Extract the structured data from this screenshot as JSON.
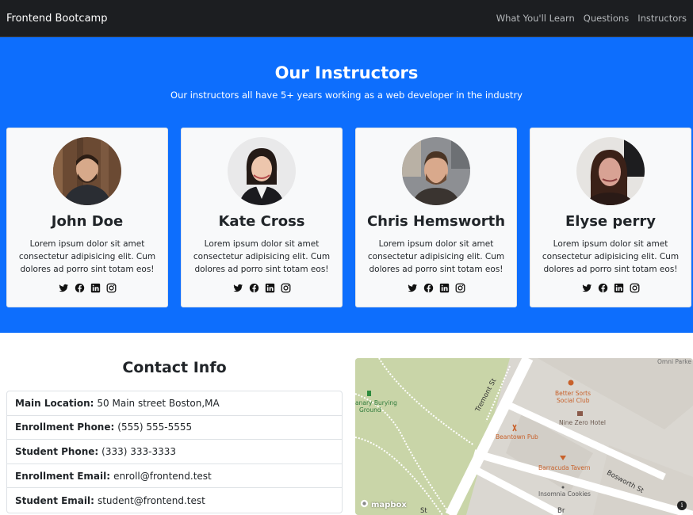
{
  "nav": {
    "brand": "Frontend Bootcamp",
    "links": [
      "What You'll Learn",
      "Questions",
      "Instructors"
    ]
  },
  "instructors": {
    "title": "Our Instructors",
    "subtitle": "Our instructors all have 5+ years working as a web developer in the industry",
    "cards": [
      {
        "name": "John Doe",
        "text": "Lorem ipsum dolor sit amet consectetur adipisicing elit. Cum dolores ad porro sint totam eos!"
      },
      {
        "name": "Kate Cross",
        "text": "Lorem ipsum dolor sit amet consectetur adipisicing elit. Cum dolores ad porro sint totam eos!"
      },
      {
        "name": "Chris Hemsworth",
        "text": "Lorem ipsum dolor sit amet consectetur adipisicing elit. Cum dolores ad porro sint totam eos!"
      },
      {
        "name": "Elyse perry",
        "text": "Lorem ipsum dolor sit amet consectetur adipisicing elit. Cum dolores ad porro sint totam eos!"
      }
    ],
    "social_icons": [
      "twitter-icon",
      "facebook-icon",
      "linkedin-icon",
      "instagram-icon"
    ]
  },
  "contact": {
    "title": "Contact Info",
    "rows": [
      {
        "label": "Main Location:",
        "value": "50 Main street Boston,MA"
      },
      {
        "label": "Enrollment Phone:",
        "value": "(555) 555-5555"
      },
      {
        "label": "Student Phone:",
        "value": "(333) 333-3333"
      },
      {
        "label": "Enrollment Email:",
        "value": "enroll@frontend.test"
      },
      {
        "label": "Student Email:",
        "value": "student@frontend.test"
      }
    ]
  },
  "map": {
    "labels": {
      "omni": "Omni Parke",
      "burying": "anary Burying",
      "ground": "Ground",
      "better_sorts": "Better Sorts",
      "social_club": "Social Club",
      "nine_zero": "Nine Zero Hotel",
      "tremont": "Tremont St",
      "beantown": "Beantown Pub",
      "barracuda": "Barracuda Tavern",
      "bosworth": "Bosworth St",
      "insomnia": "Insomnia Cookies",
      "st": "St",
      "br": "Br"
    },
    "logo": "mapbox",
    "info": "i"
  },
  "colors": {
    "primary": "#0d6efd",
    "navbar": "#1c1e21",
    "card": "#f8f9fa",
    "park": "#c9d5a8",
    "poi": "#c8612b"
  }
}
